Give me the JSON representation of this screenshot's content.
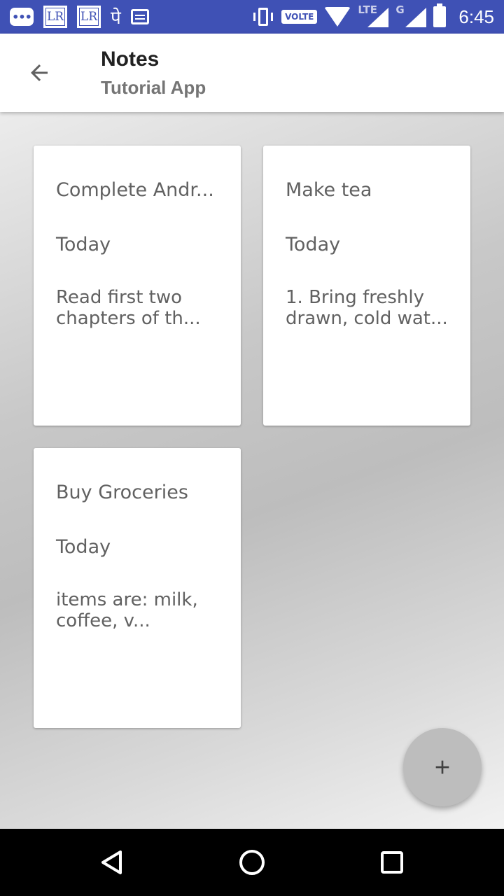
{
  "status_bar": {
    "time": "6:45",
    "lr_1": "LR",
    "lr_2": "LR",
    "glyph": "पे",
    "volte": "VOLTE",
    "lte": "LTE",
    "g": "G"
  },
  "app_bar": {
    "title": "Notes",
    "subtitle": "Tutorial App"
  },
  "notes": [
    {
      "title": "Complete Andr...",
      "date": "Today",
      "body": "Read first two chapters of th..."
    },
    {
      "title": "Make tea",
      "date": "Today",
      "body": "1. Bring freshly drawn, cold wat..."
    },
    {
      "title": "Buy Groceries",
      "date": "Today",
      "body": "items are: milk, coffee, v..."
    }
  ],
  "fab": {
    "icon": "plus-icon"
  },
  "colors": {
    "status_bar": "#3f51b5",
    "app_bar": "#ffffff",
    "card_text": "#616161",
    "fab": "#bdbdbd"
  }
}
